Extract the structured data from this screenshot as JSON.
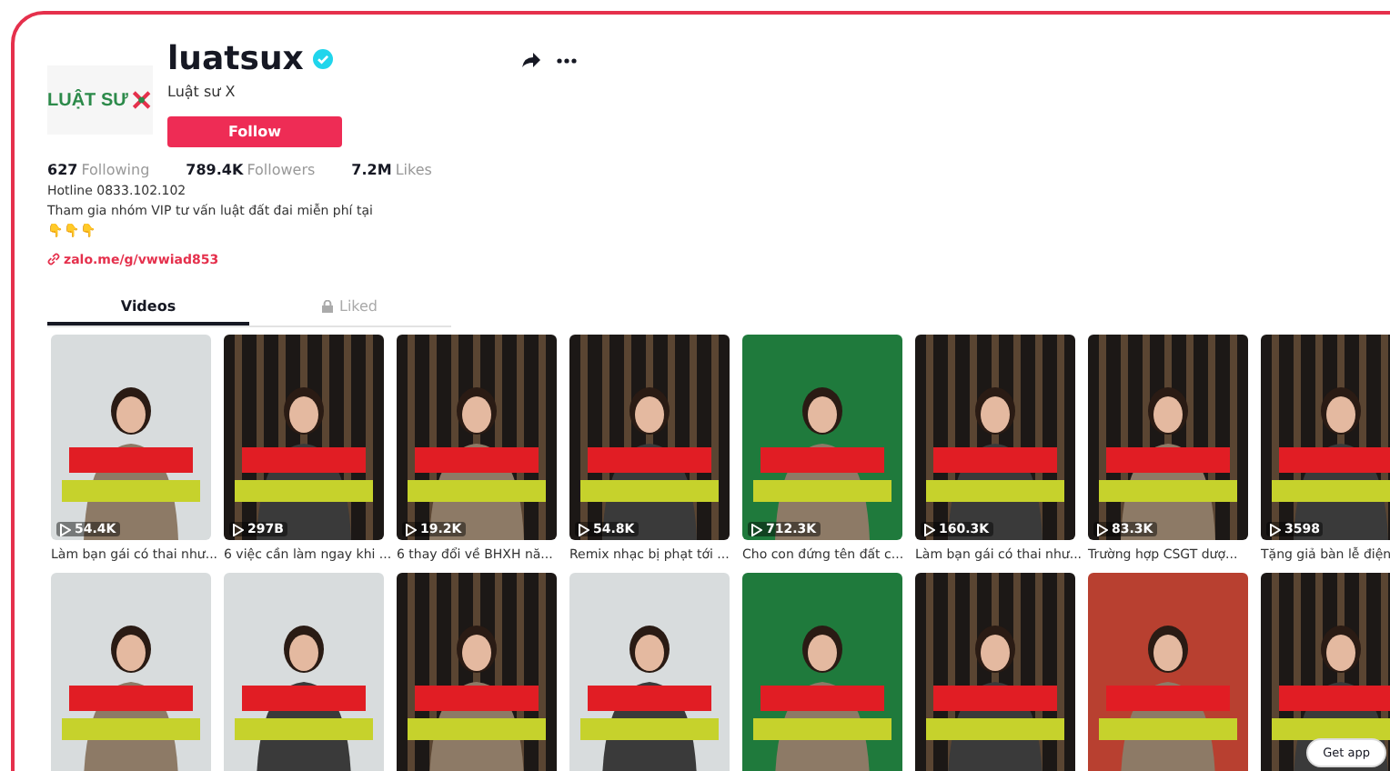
{
  "profile": {
    "logo_text": "LUẬT SƯ",
    "username": "luatsux",
    "verified": true,
    "display_name": "Luật sư X",
    "follow_button": "Follow",
    "stats": [
      {
        "value": "627",
        "label": "Following"
      },
      {
        "value": "789.4K",
        "label": "Followers"
      },
      {
        "value": "7.2M",
        "label": "Likes"
      }
    ],
    "bio": [
      "Hotline 0833.102.102",
      "Tham gia nhóm VIP tư vấn luật đất đai miễn phí tại",
      "👇👇👇"
    ],
    "link": "zalo.me/g/vwwiad853"
  },
  "tabs": [
    {
      "label": "Videos",
      "selected": true,
      "locked": false
    },
    {
      "label": "Liked",
      "selected": false,
      "locked": true
    }
  ],
  "videos": [
    {
      "kind": "video",
      "views": "54.4K",
      "caption": "Làm bạn gái có thai như..."
    },
    {
      "kind": "video",
      "views": "297B",
      "caption": "6 việc cần làm ngay khi ..."
    },
    {
      "kind": "video",
      "views": "19.2K",
      "caption": "6 thay đổi về BHXH nă..."
    },
    {
      "kind": "video",
      "views": "54.8K",
      "caption": "Remix nhạc bị phạt tới ..."
    },
    {
      "kind": "video",
      "views": "712.3K",
      "caption": "Cho con đứng tên đất c..."
    },
    {
      "kind": "video",
      "views": "160.3K",
      "caption": "Làm bạn gái có thai như..."
    },
    {
      "kind": "video",
      "views": "83.3K",
      "caption": "Trường hợp CSGT dượ..."
    },
    {
      "kind": "video",
      "views": "3598",
      "caption": "Tặng giả bàn lễ điện"
    },
    {
      "kind": "video"
    },
    {
      "kind": "video"
    },
    {
      "kind": "video"
    },
    {
      "kind": "video"
    },
    {
      "kind": "video"
    },
    {
      "kind": "video"
    },
    {
      "kind": "video"
    },
    {
      "kind": "video"
    }
  ],
  "get_app_button": "Get app"
}
